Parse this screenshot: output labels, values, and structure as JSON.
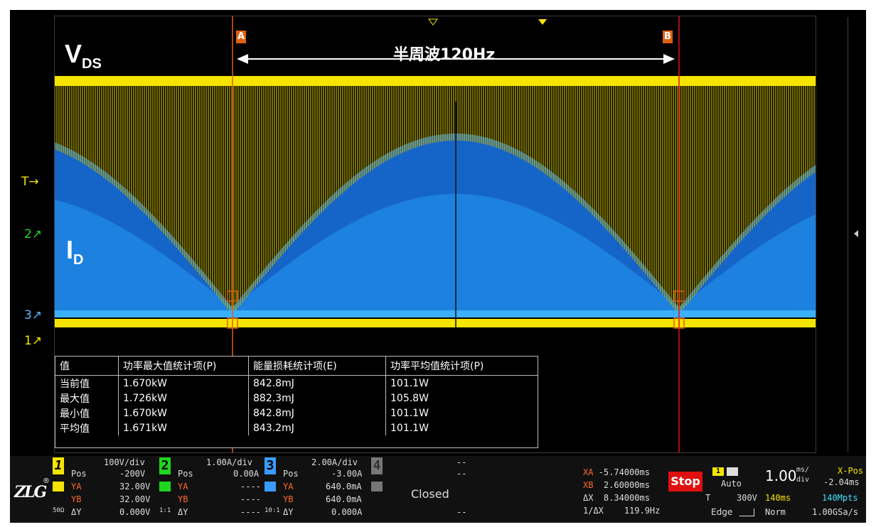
{
  "title_vds": "V",
  "title_vds_sub": "DS",
  "title_id": "I",
  "title_id_sub": "D",
  "half_wave_label": "半周波120Hz",
  "cursor_a": "A",
  "cursor_b": "B",
  "left_markers": {
    "T": "T",
    "ch2": "2",
    "ch3": "3",
    "ch1": "1"
  },
  "measurement_table": {
    "headers": [
      "值",
      "功率最大值统计项(P)",
      "能量损耗统计项(E)",
      "功率平均值统计项(P)"
    ],
    "rows": [
      [
        "当前值",
        "1.670kW",
        "842.8mJ",
        "101.1W"
      ],
      [
        "最大值",
        "1.726kW",
        "882.3mJ",
        "105.8W"
      ],
      [
        "最小值",
        "1.670kW",
        "842.8mJ",
        "101.1W"
      ],
      [
        "平均值",
        "1.671kW",
        "843.2mJ",
        "101.1W"
      ]
    ]
  },
  "logo": "ZLG",
  "channels": [
    {
      "num": "1",
      "scale": "100V/div",
      "pos_label": "Pos",
      "pos": "-200V",
      "ya_label": "YA",
      "ya": "32.00V",
      "yb_label": "YB",
      "yb": "32.00V",
      "dy_label": "ΔY",
      "dy": "0.000V",
      "imp": "50Ω",
      "color": "#f5e400"
    },
    {
      "num": "2",
      "scale": "1.00A/div",
      "pos_label": "Pos",
      "pos": "0.00A",
      "ya_label": "YA",
      "ya": "----",
      "yb_label": "YB",
      "yb": "----",
      "dy_label": "ΔY",
      "dy": "----",
      "imp": "1:1",
      "color": "#1ed61e"
    },
    {
      "num": "3",
      "scale": "2.00A/div",
      "pos_label": "Pos",
      "pos": "-3.00A",
      "ya_label": "YA",
      "ya": "640.0mA",
      "yb_label": "YB",
      "yb": "640.0mA",
      "dy_label": "ΔY",
      "dy": "0.000A",
      "imp": "10:1",
      "color": "#3a9cff"
    },
    {
      "num": "4",
      "scale": "--",
      "pos": "--",
      "state": "Closed",
      "dy": "--",
      "color": "#777777"
    }
  ],
  "cursors": {
    "xa_label": "XA",
    "xa": "-5.74000ms",
    "xb_label": "XB",
    "xb": "2.60000ms",
    "dx_label": "ΔX",
    "dx": "8.34000ms",
    "inv_dx_label": "1/ΔX",
    "inv_dx": "119.9Hz"
  },
  "run_state": "Stop",
  "trigger": {
    "source": "1",
    "mode": "Auto",
    "label": "T",
    "level": "300V",
    "type": "Edge"
  },
  "timebase": {
    "value": "1.00",
    "unit_top": "ms/",
    "unit_bottom": "div",
    "xpos_label": "X-Pos",
    "xpos": "-2.04ms",
    "span": "140ms",
    "points": "140Mpts",
    "acq": "Norm",
    "rate": "1.00GSa/s"
  }
}
